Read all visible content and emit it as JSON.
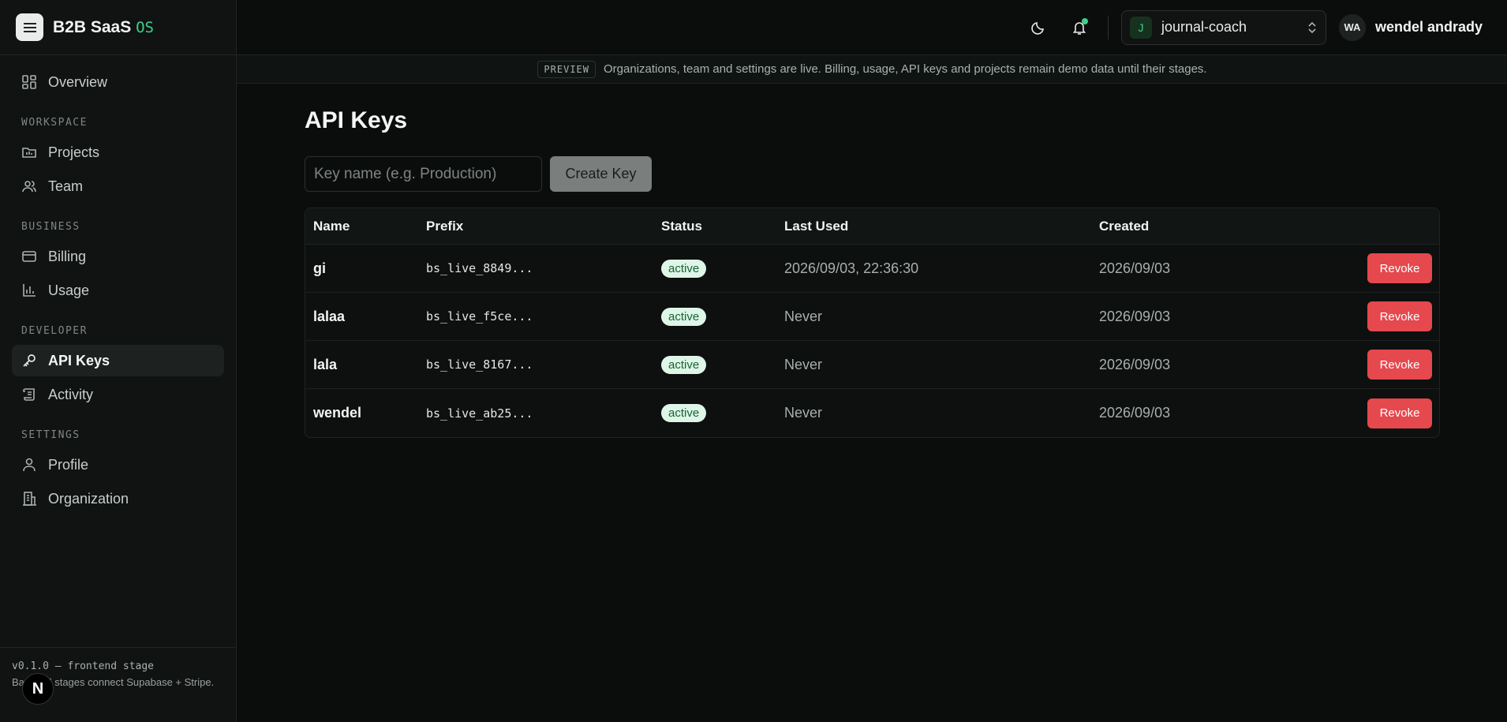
{
  "brand": {
    "title": "B2B SaaS",
    "suffix": "OS"
  },
  "nav": {
    "overview": "Overview",
    "section_workspace": "WORKSPACE",
    "projects": "Projects",
    "team": "Team",
    "section_business": "BUSINESS",
    "billing": "Billing",
    "usage": "Usage",
    "section_developer": "DEVELOPER",
    "api_keys": "API Keys",
    "activity": "Activity",
    "section_settings": "SETTINGS",
    "profile": "Profile",
    "organization": "Organization"
  },
  "footer": {
    "version": "v0.1.0 — frontend stage",
    "note": "Backend stages connect Supabase + Stripe.",
    "next_badge": "N"
  },
  "topbar": {
    "org": {
      "initial": "J",
      "name": "journal-coach"
    },
    "user": {
      "initials": "WA",
      "name": "wendel andrady"
    }
  },
  "preview": {
    "tag": "PREVIEW",
    "text": "Organizations, team and settings are live. Billing, usage, API keys and projects remain demo data until their stages."
  },
  "page": {
    "title": "API Keys",
    "input_placeholder": "Key name (e.g. Production)",
    "create_label": "Create Key"
  },
  "table": {
    "headers": {
      "name": "Name",
      "prefix": "Prefix",
      "status": "Status",
      "last_used": "Last Used",
      "created": "Created"
    },
    "rows": [
      {
        "name": "gi",
        "prefix": "bs_live_8849...",
        "status": "active",
        "last_used": "2026/09/03, 22:36:30",
        "created": "2026/09/03",
        "action": "Revoke"
      },
      {
        "name": "lalaa",
        "prefix": "bs_live_f5ce...",
        "status": "active",
        "last_used": "Never",
        "created": "2026/09/03",
        "action": "Revoke"
      },
      {
        "name": "lala",
        "prefix": "bs_live_8167...",
        "status": "active",
        "last_used": "Never",
        "created": "2026/09/03",
        "action": "Revoke"
      },
      {
        "name": "wendel",
        "prefix": "bs_live_ab25...",
        "status": "active",
        "last_used": "Never",
        "created": "2026/09/03",
        "action": "Revoke"
      }
    ]
  },
  "colors": {
    "accent": "#3ecf8e",
    "danger": "#e5484d",
    "background": "#0b0d0c"
  }
}
